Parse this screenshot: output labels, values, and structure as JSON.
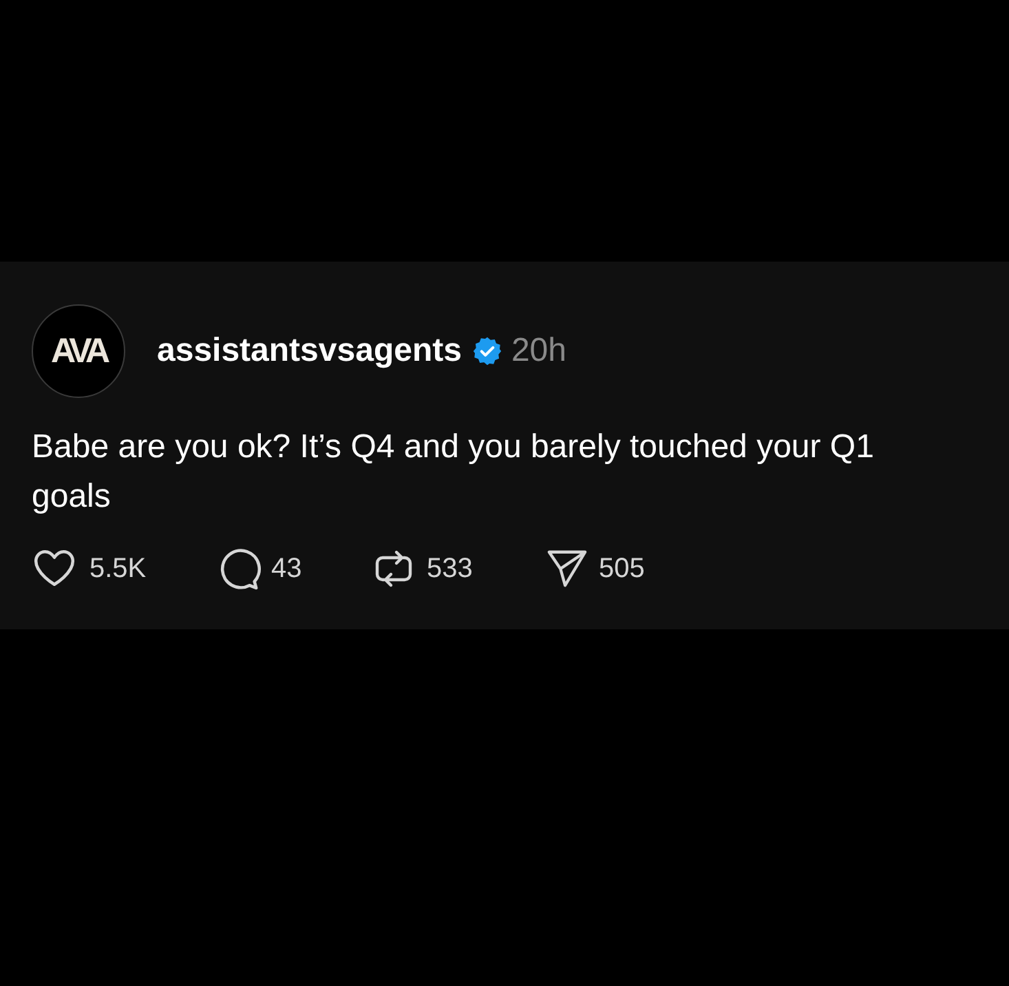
{
  "post": {
    "author": {
      "avatar_text": "AVA",
      "username": "assistantsvsagents",
      "verified": true,
      "time": "20h"
    },
    "text": "Babe are you ok? It’s Q4 and you barely touched your Q1 goals",
    "actions": [
      {
        "kind": "like",
        "count": "5.5K"
      },
      {
        "kind": "reply",
        "count": "43"
      },
      {
        "kind": "repost",
        "count": "533"
      },
      {
        "kind": "share",
        "count": "505"
      }
    ]
  }
}
